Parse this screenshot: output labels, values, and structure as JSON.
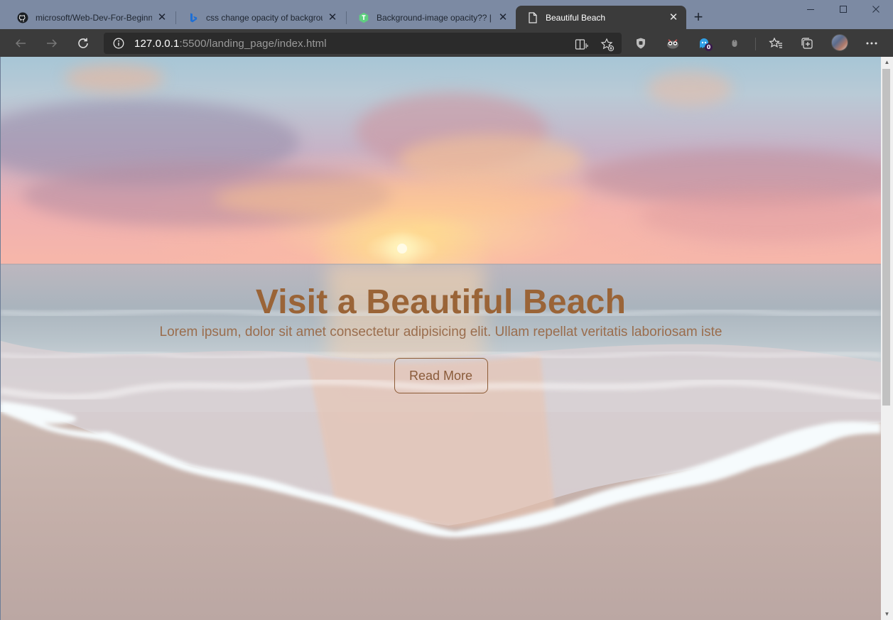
{
  "browser": {
    "tabs": [
      {
        "title": "microsoft/Web-Dev-For-Beginners",
        "icon": "github-icon",
        "active": false
      },
      {
        "title": "css change opacity of background",
        "icon": "bing-icon",
        "active": false
      },
      {
        "title": "Background-image opacity?? | Tr",
        "icon": "treehouse-icon",
        "active": false
      },
      {
        "title": "Beautiful Beach",
        "icon": "page-icon",
        "active": true
      }
    ],
    "new_tab_icon": "plus-icon",
    "window_controls": [
      "minimize-icon",
      "maximize-icon",
      "close-icon"
    ],
    "address": {
      "host": "127.0.0.1",
      "rest": ":5500/landing_page/index.html"
    },
    "extension_badge": "0"
  },
  "page": {
    "title": "Visit a Beautiful Beach",
    "text": "Lorem ipsum, dolor sit amet consectetur adipisicing elit. Ullam repellat veritatis laboriosam iste",
    "button_label": "Read More"
  },
  "colors": {
    "title": "#9a6437",
    "button_border": "#8d5c37",
    "tab_active": "#3b3b3b",
    "titlebar": "#7c8aa3"
  }
}
